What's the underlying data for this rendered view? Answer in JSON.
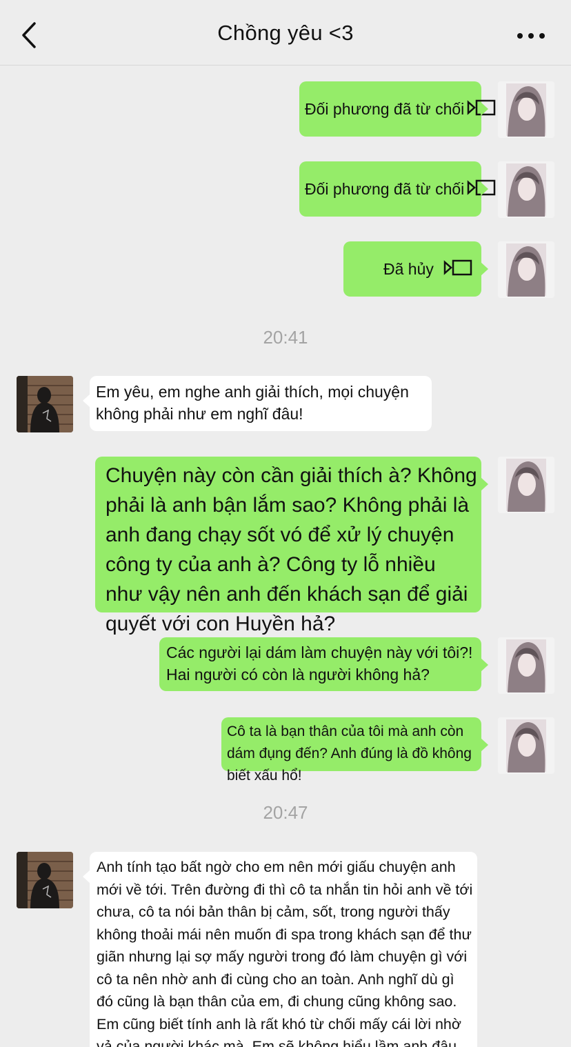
{
  "header": {
    "title": "Chồng yêu <3",
    "back_icon": "chevron-left-icon",
    "more_icon": "more-dots-icon"
  },
  "colors": {
    "my_bubble": "#95ec69",
    "their_bubble": "#ffffff",
    "background": "#ededed"
  },
  "messages": [
    {
      "sender": "me",
      "text": "Đối phương đã từ chối",
      "icon": "video-call-icon"
    },
    {
      "sender": "me",
      "text": "Đối phương đã từ chối",
      "icon": "video-call-icon"
    },
    {
      "sender": "me",
      "text": "Đã hủy",
      "icon": "video-call-icon"
    },
    {
      "time": "20:41"
    },
    {
      "sender": "him",
      "text": "Em yêu, em nghe anh giải thích, mọi chuyện không phải như em nghĩ đâu!"
    },
    {
      "sender": "me",
      "text": "Chuyện này còn cần giải thích à? Không phải là anh bận lắm sao? Không phải là anh đang chạy sốt vó để xử lý chuyện công ty của anh à? Công ty lỗ nhiều như vậy nên anh đến khách sạn để giải quyết với con Huyền hả?"
    },
    {
      "sender": "me",
      "text": "Các người lại dám làm chuyện này với tôi?! Hai người có còn là người không hả?"
    },
    {
      "sender": "me",
      "text": "Cô ta là bạn thân của tôi mà anh còn dám đụng đến? Anh đúng là đồ không biết xấu hổ!"
    },
    {
      "time": "20:47"
    },
    {
      "sender": "him",
      "text": "Anh tính tạo bất ngờ cho em nên mới giấu chuyện anh mới về tới. Trên đường đi thì cô ta nhắn tin hỏi anh về tới chưa, cô ta nói bản thân bị cảm, sốt, trong người thấy không thoải mái nên muốn đi spa trong khách sạn để thư giãn nhưng lại sợ mấy người trong đó làm chuyện gì với cô ta nên nhờ anh đi cùng cho an toàn. Anh nghĩ dù gì đó cũng là bạn thân của em, đi chung cũng không sao. Em cũng biết tính anh là rất khó từ chối mấy cái lời nhờ vả của người khác mà. Em sẽ không hiểu lầm anh đâu đúng không?"
    }
  ]
}
